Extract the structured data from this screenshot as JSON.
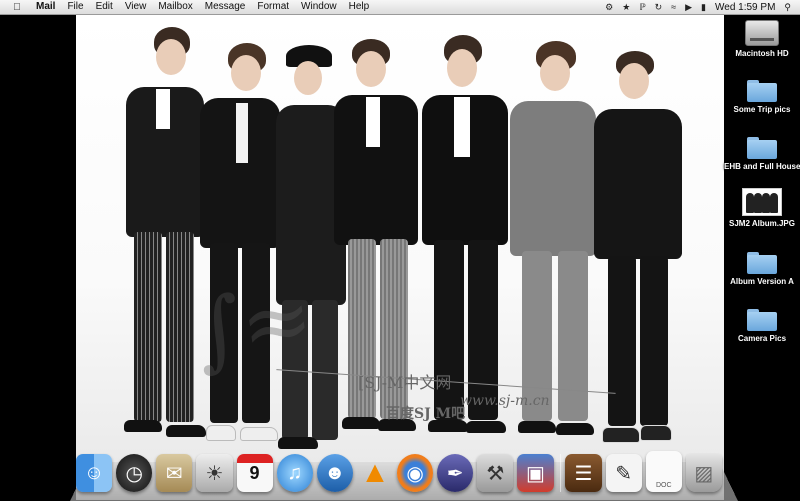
{
  "menubar": {
    "app_name": "Mail",
    "items": [
      "File",
      "Edit",
      "View",
      "Mailbox",
      "Message",
      "Format",
      "Window",
      "Help"
    ],
    "clock": "Wed 1:59 PM"
  },
  "watermark": {
    "site_cn": "[SJ-M中文网",
    "url": "www.sj-m.cn",
    "baidu": "百度SJ M吧"
  },
  "desktop": {
    "icons": [
      {
        "label": "Macintosh HD",
        "icon": "hard-drive-icon"
      },
      {
        "label": "Some Trip pics",
        "icon": "folder-icon"
      },
      {
        "label": "EHB and Full House",
        "icon": "folder-icon"
      },
      {
        "label": "SJM2 Album.JPG",
        "icon": "image-file-icon"
      },
      {
        "label": "Album Version A",
        "icon": "folder-icon"
      },
      {
        "label": "Camera Pics",
        "icon": "folder-icon"
      }
    ]
  },
  "calendar_day": "9",
  "dock": {
    "items": [
      "finder-icon",
      "dashboard-icon",
      "mail-icon",
      "preview-icon",
      "ical-icon",
      "itunes-icon",
      "chat-icon",
      "vlc-icon",
      "firefox-icon",
      "script-editor-icon",
      "directory-utility-icon",
      "vmware-icon",
      "books-icon",
      "textedit-icon",
      "document-icon",
      "trash-icon"
    ],
    "doc_label": "DOC"
  }
}
